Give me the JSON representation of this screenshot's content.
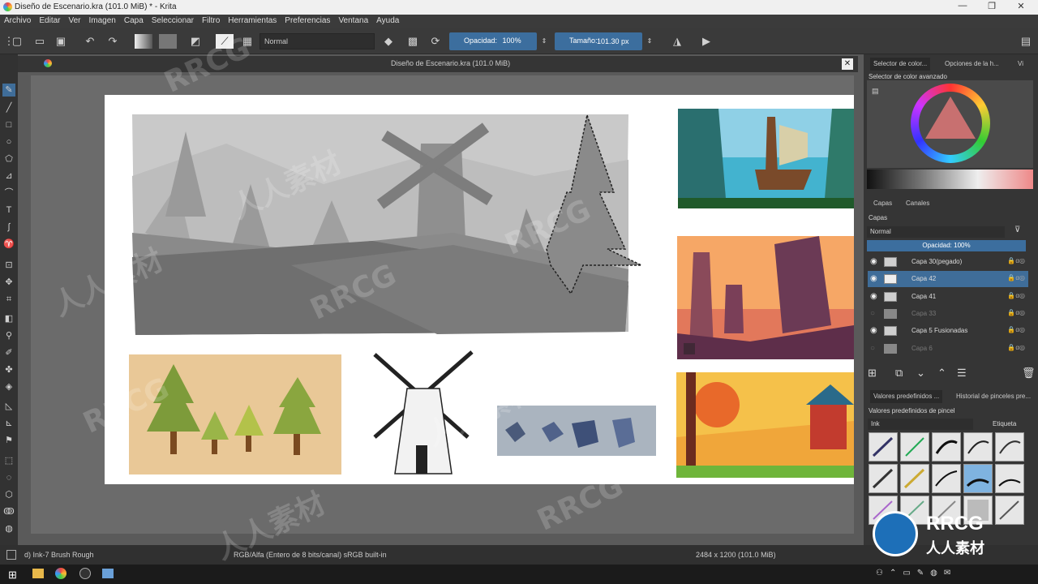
{
  "window": {
    "title": "Diseño de Escenario.kra (101.0 MiB) * - Krita",
    "min": "—",
    "max": "❐",
    "close": "✕"
  },
  "menu": [
    "Archivo",
    "Editar",
    "Ver",
    "Imagen",
    "Capa",
    "Seleccionar",
    "Filtro",
    "Herramientas",
    "Preferencias",
    "Ventana",
    "Ayuda"
  ],
  "toolbar": {
    "blend_mode": "Normal",
    "opacity_label": "Opacidad:",
    "opacity_value": "100%",
    "size_label": "Tamaño:",
    "size_value": "101.30 px"
  },
  "document": {
    "tab_title": "Diseño de Escenario.kra (101.0 MiB)"
  },
  "right_dock": {
    "top_tabs": [
      "Selector de color...",
      "Opciones de la h...",
      "Vi"
    ],
    "color_selector_title": "Selector de color avanzado",
    "layers_tabs": [
      "Capas",
      "Canales"
    ],
    "layers_title": "Capas",
    "layers_blend": "Normal",
    "layers_opacity": "Opacidad:  100%",
    "layers": [
      {
        "name": "Capa 30(pegado)",
        "visible": true,
        "selected": false
      },
      {
        "name": "Capa 42",
        "visible": true,
        "selected": true
      },
      {
        "name": "Capa 41",
        "visible": true,
        "selected": false
      },
      {
        "name": "Capa 33",
        "visible": false,
        "selected": false
      },
      {
        "name": "Capa 5 Fusionadas",
        "visible": true,
        "selected": false
      },
      {
        "name": "Capa 6",
        "visible": false,
        "selected": false
      }
    ],
    "presets_tabs": [
      "Valores predefinidos ...",
      "Historial de pinceles pre..."
    ],
    "presets_title": "Valores predefinidos de pincel",
    "presets_tag": "Ink",
    "presets_tag_btn": "Etiqueta"
  },
  "status": {
    "brush": "d) Ink-7 Brush Rough",
    "color_space": "RGB/Alfa (Entero de 8 bits/canal)  sRGB built-in",
    "dims": "2484 x 1200 (101.0 MiB)"
  },
  "watermark": "RRCG",
  "watermark_cn": "人人素材",
  "colors": {
    "accent": "#3c6e9e",
    "selected_layer": "#3f6d99",
    "panel": "#353535"
  }
}
